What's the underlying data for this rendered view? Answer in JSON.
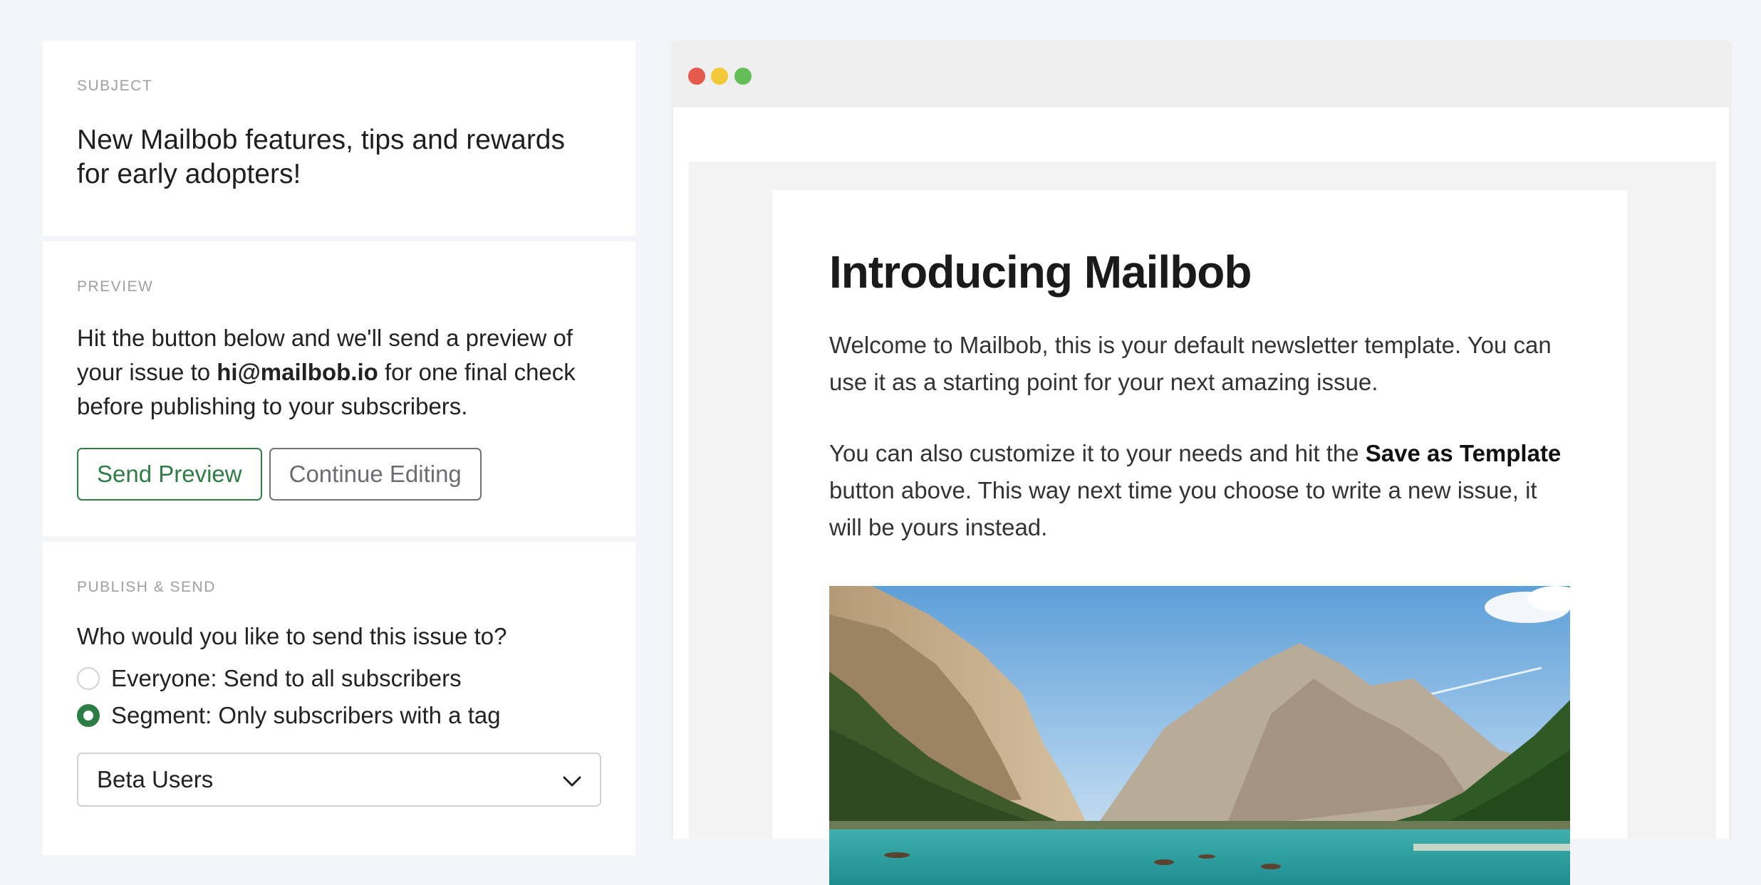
{
  "subject": {
    "label": "SUBJECT",
    "text": "New Mailbob features, tips and rewards for early adopters!"
  },
  "preview": {
    "label": "PREVIEW",
    "text_before": "Hit the button below and we'll send a preview of your issue to ",
    "email": "hi@mailbob.io",
    "text_after": " for one final check before publishing to your subscribers.",
    "send_button": "Send Preview",
    "continue_button": "Continue Editing"
  },
  "publish": {
    "label": "PUBLISH & SEND",
    "question": "Who would you like to send this issue to?",
    "options": [
      {
        "label": "Everyone: Send to all subscribers",
        "checked": false
      },
      {
        "label": "Segment: Only subscribers with a tag",
        "checked": true
      }
    ],
    "segment_select": "Beta Users"
  },
  "browser": {
    "dots": [
      "#e45a4c",
      "#f3c93a",
      "#63bf55"
    ]
  },
  "email": {
    "title": "Introducing Mailbob",
    "p1": "Welcome to Mailbob, this is your default newsletter template. You can use it as a starting point for your next amazing issue.",
    "p2_before": "You can also customize it to your needs and hit the ",
    "p2_bold": "Save as Template",
    "p2_after": " button above. This way next time you choose to write a new issue, it will be yours instead."
  },
  "colors": {
    "accent": "#2e7d44",
    "background": "#f4f5f8"
  }
}
